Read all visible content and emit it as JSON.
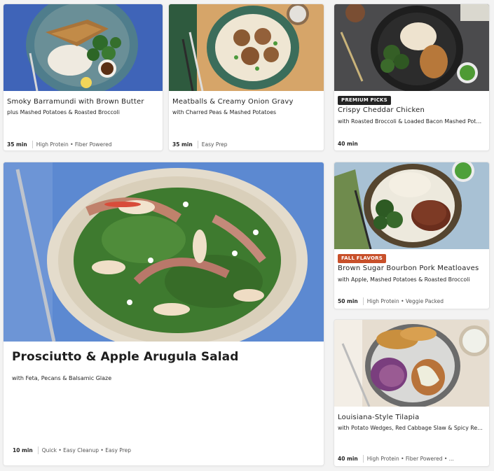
{
  "colors": {
    "premium_tag": "#242424",
    "fall_tag": "#c8502a",
    "card_bg": "#ffffff",
    "page_bg": "#f3f3f3"
  },
  "cards": [
    {
      "title": "Smoky Barramundi with Brown Butter",
      "subtitle": "plus Mashed Potatoes & Roasted Broccoli",
      "time": "35 min",
      "tags": "High Protein • Fiber Powered"
    },
    {
      "title": "Meatballs & Creamy Onion Gravy",
      "subtitle": "with Charred Peas & Mashed Potatoes",
      "time": "35 min",
      "tags": "Easy Prep"
    },
    {
      "badge": "PREMIUM PICKS",
      "title": "Crispy Cheddar Chicken",
      "subtitle": "with Roasted Broccoli & Loaded Bacon Mashed Potatoes",
      "time": "40 min",
      "tags": ""
    },
    {
      "title": "Prosciutto & Apple Arugula Salad",
      "subtitle": "with Feta, Pecans & Balsamic Glaze",
      "time": "10 min",
      "tags": "Quick • Easy Cleanup • Easy Prep"
    },
    {
      "badge": "FALL FLAVORS",
      "title": "Brown Sugar Bourbon Pork Meatloaves",
      "subtitle": "with Apple, Mashed Potatoes & Roasted Broccoli",
      "time": "50 min",
      "tags": "High Protein • Veggie Packed"
    },
    {
      "title": "Louisiana-Style Tilapia",
      "subtitle": "with Potato Wedges, Red Cabbage Slaw & Spicy Remoulade",
      "time": "40 min",
      "tags": "High Protein • Fiber Powered • ..."
    }
  ]
}
